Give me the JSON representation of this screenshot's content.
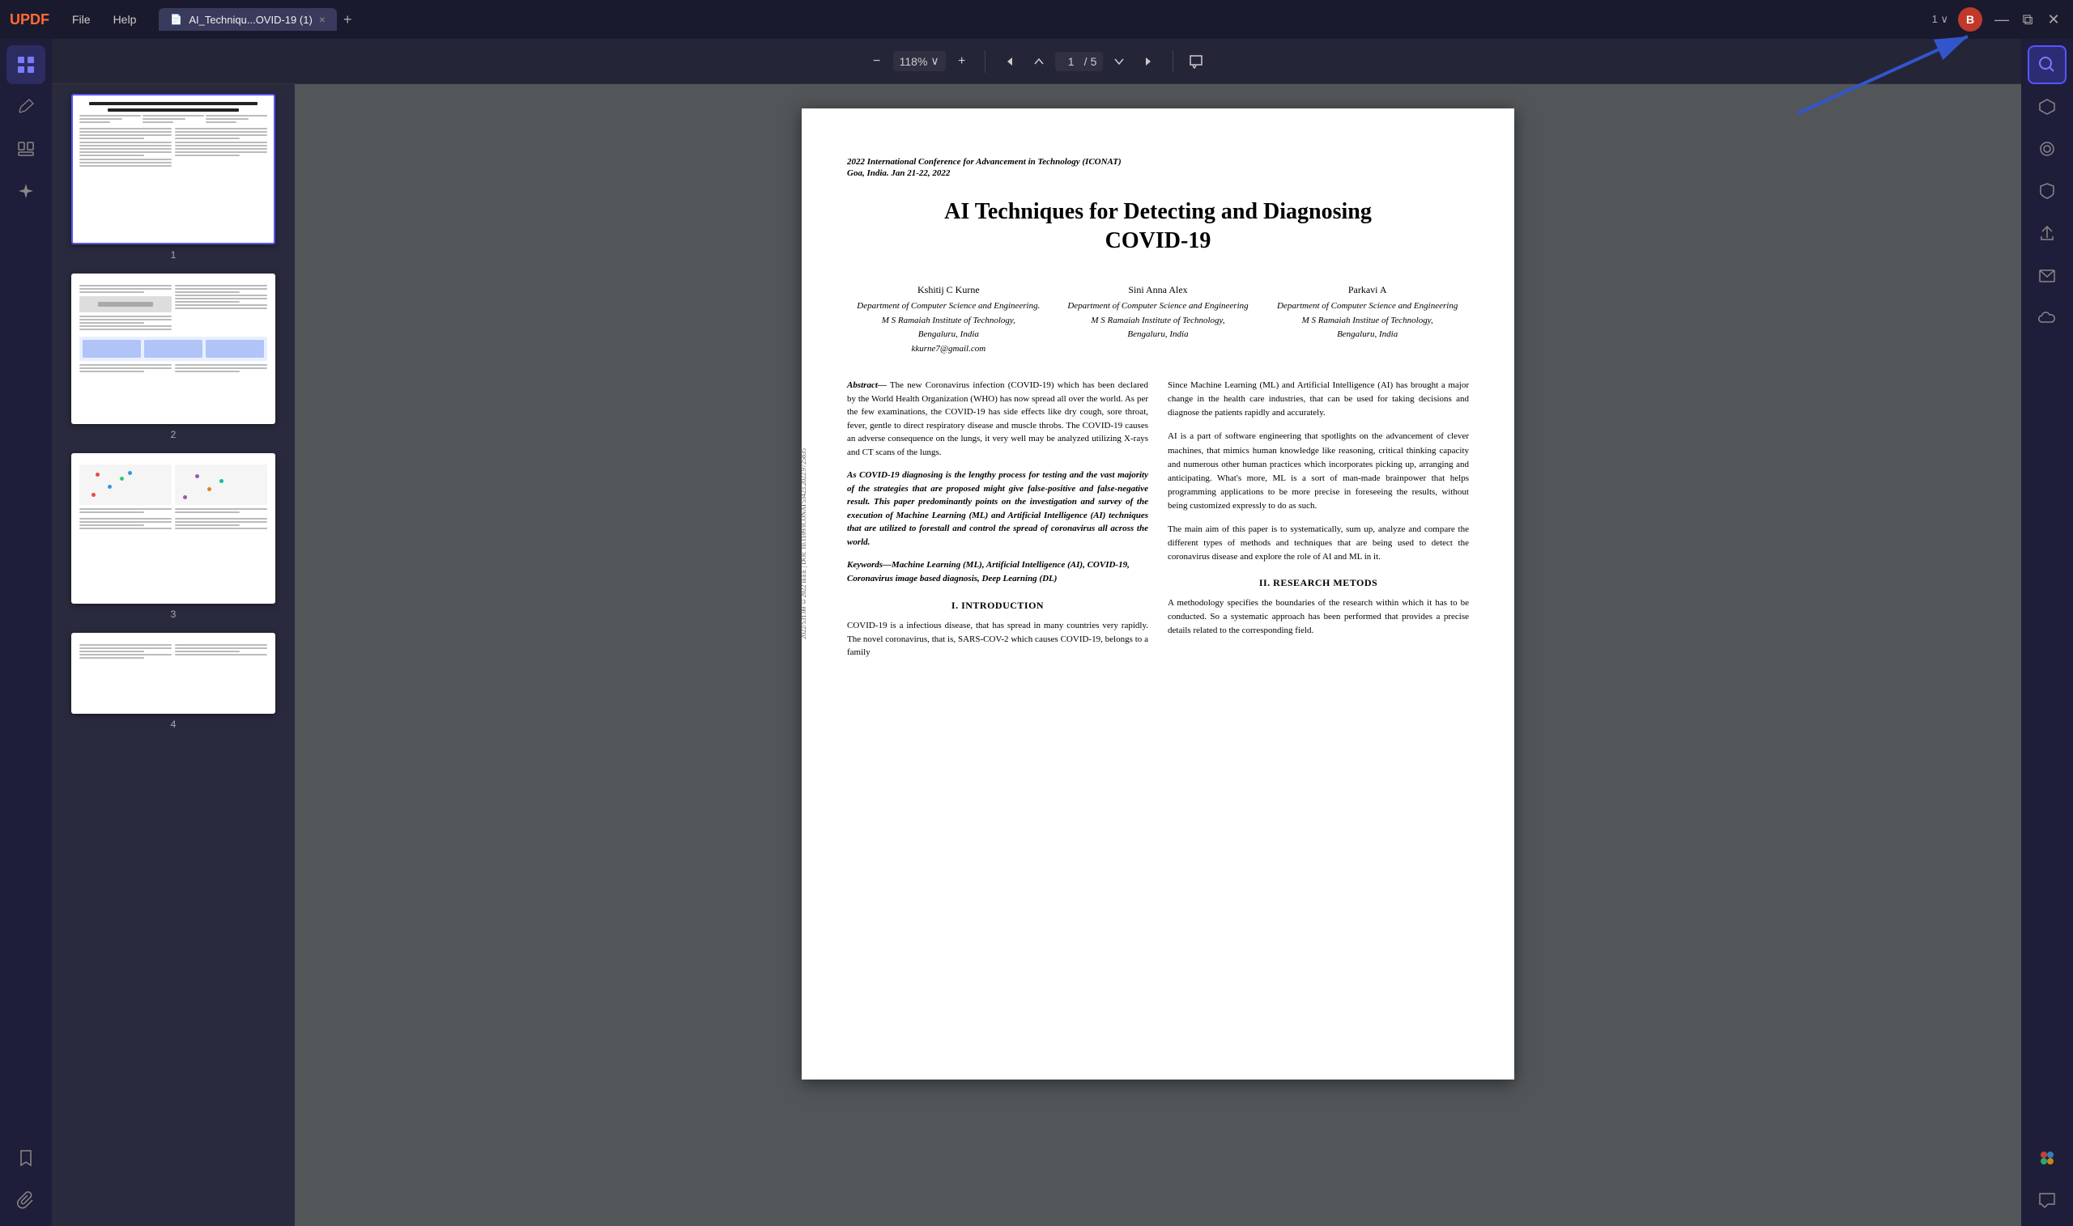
{
  "app": {
    "name": "UPDF",
    "logo": "UPDF"
  },
  "titlebar": {
    "menu_items": [
      "File",
      "Help"
    ],
    "tab_title": "AI_Techniqu...OVID-19 (1)",
    "tab_close": "×",
    "tab_add": "+",
    "version": "1",
    "user_initial": "B",
    "window_minimize": "—",
    "window_restore": "⧉",
    "window_close": "✕"
  },
  "toolbar": {
    "zoom_out": "−",
    "zoom_level": "118%",
    "zoom_in": "+",
    "zoom_chevron": "∨",
    "page_first_up": "↑",
    "page_up": "↑",
    "page_current": "1",
    "page_separator": "/",
    "page_total": "5",
    "page_down": "↓",
    "page_last": "↓",
    "comment": "💬"
  },
  "sidebar_left": {
    "icons": [
      {
        "name": "thumbnail-view",
        "symbol": "⊞",
        "active": true
      },
      {
        "name": "annotation",
        "symbol": "✏️",
        "active": false
      },
      {
        "name": "organize",
        "symbol": "☰",
        "active": false
      },
      {
        "name": "ai",
        "symbol": "✦",
        "active": false
      },
      {
        "name": "bookmark",
        "symbol": "🔖",
        "active": false
      },
      {
        "name": "attachment",
        "symbol": "📎",
        "active": false
      }
    ]
  },
  "sidebar_right": {
    "icons": [
      {
        "name": "search",
        "symbol": "🔍",
        "active": true
      },
      {
        "name": "convert",
        "symbol": "⬡",
        "active": false
      },
      {
        "name": "ocr",
        "symbol": "⊙",
        "active": false
      },
      {
        "name": "protect",
        "symbol": "🛡",
        "active": false
      },
      {
        "name": "share",
        "symbol": "↑",
        "active": false
      },
      {
        "name": "mail",
        "symbol": "✉",
        "active": false
      },
      {
        "name": "cloud",
        "symbol": "☁",
        "active": false
      }
    ],
    "bottom_icons": [
      {
        "name": "colorful-logo",
        "symbol": "✦",
        "active": false
      },
      {
        "name": "chat",
        "symbol": "💬",
        "active": false
      }
    ]
  },
  "thumbnails": [
    {
      "page_num": "1",
      "selected": true
    },
    {
      "page_num": "2",
      "selected": false
    },
    {
      "page_num": "3",
      "selected": false
    },
    {
      "page_num": "4",
      "selected": false
    }
  ],
  "pdf": {
    "conference_line1": "2022 International Conference for Advancement in Technology (ICONAT)",
    "conference_line2": "Goa, India. Jan 21-22, 2022",
    "title_line1": "AI Techniques for Detecting and Diagnosing",
    "title_line2": "COVID-19",
    "authors": [
      {
        "name": "Kshitij C Kurne",
        "dept": "Department of Computer Science and Engineering.",
        "institute": "M S Ramaiah Institute of Technology,",
        "city": "Bengaluru, India",
        "email": "kkurne7@gmail.com"
      },
      {
        "name": "Sini Anna Alex",
        "dept": "Department of Computer Science and Engineering",
        "institute": "M S Ramaiah Institute of Technology,",
        "city": "Bengaluru, India",
        "email": ""
      },
      {
        "name": "Parkavi A",
        "dept": "Department of Computer Science and Engineering",
        "institute": "M S Ramaiah Institue of Technology,",
        "city": "Bengaluru, India",
        "email": ""
      }
    ],
    "abstract_label": "Abstract—",
    "abstract_text": " The new Coronavirus infection (COVID-19) which has been declared by the World Health Organization (WHO) has now spread all over the world. As per the few examinations, the COVID-19 has side effects like dry cough, sore throat, fever, gentle to direct respiratory disease and muscle throbs. The COVID-19 causes an adverse consequence on the lungs, it very well may be analyzed utilizing X-rays and CT scans of the lungs.",
    "abstract_p2": "As COVID-19 diagnosing is the lengthy process for testing and the vast majority of the strategies that are proposed might give false-positive and false-negative result. This paper predominantly points on the investigation and survey of the execution of Machine Learning (ML) and Artificial Intelligence (AI) techniques that are utilized to forestall and control the spread of coronavirus all across the world.",
    "keywords_label": "Keywords—",
    "keywords_text": "Machine Learning (ML), Artificial Intelligence (AI), COVID-19, Coronavirus image based diagnosis, Deep Learning (DL)",
    "section1_header": "I.    Introduction",
    "section1_text": "COVID-19 is a infectious disease, that has spread in many countries very rapidly. The novel coronavirus, that is, SARS-COV-2 which causes COVID-19, belongs to a family",
    "right_col_p1": "Since Machine Learning (ML) and Artificial Intelligence (AI) has brought a major change in the health care industries, that can be used for taking decisions and diagnose the patients rapidly and accurately.",
    "right_col_p2": "AI is a part of software engineering that spotlights on the advancement of clever machines, that mimics human knowledge like reasoning, critical thinking capacity and numerous other human practices which incorporates picking up, arranging and anticipating. What's more, ML is a sort of man-made brainpower that helps programming applications to be more precise in foreseeing the results, without being customized expressly to do as such.",
    "right_col_p3": "The main aim of this paper is to systematically, sum up, analyze and compare the different types of methods and techniques that are being used to detect the coronavirus disease and explore the role of AI and ML in it.",
    "section2_header": "II.    RESEARCH METODS",
    "section2_text": "A methodology specifies the boundaries of the research within which it has to be conducted. So a systematic approach has been performed that provides a precise details related to the corresponding field.",
    "margin_text": "2022/531.00 ©2022 IEEE | DOI: 10.1109/ICONAT53423.2022.9725835"
  }
}
